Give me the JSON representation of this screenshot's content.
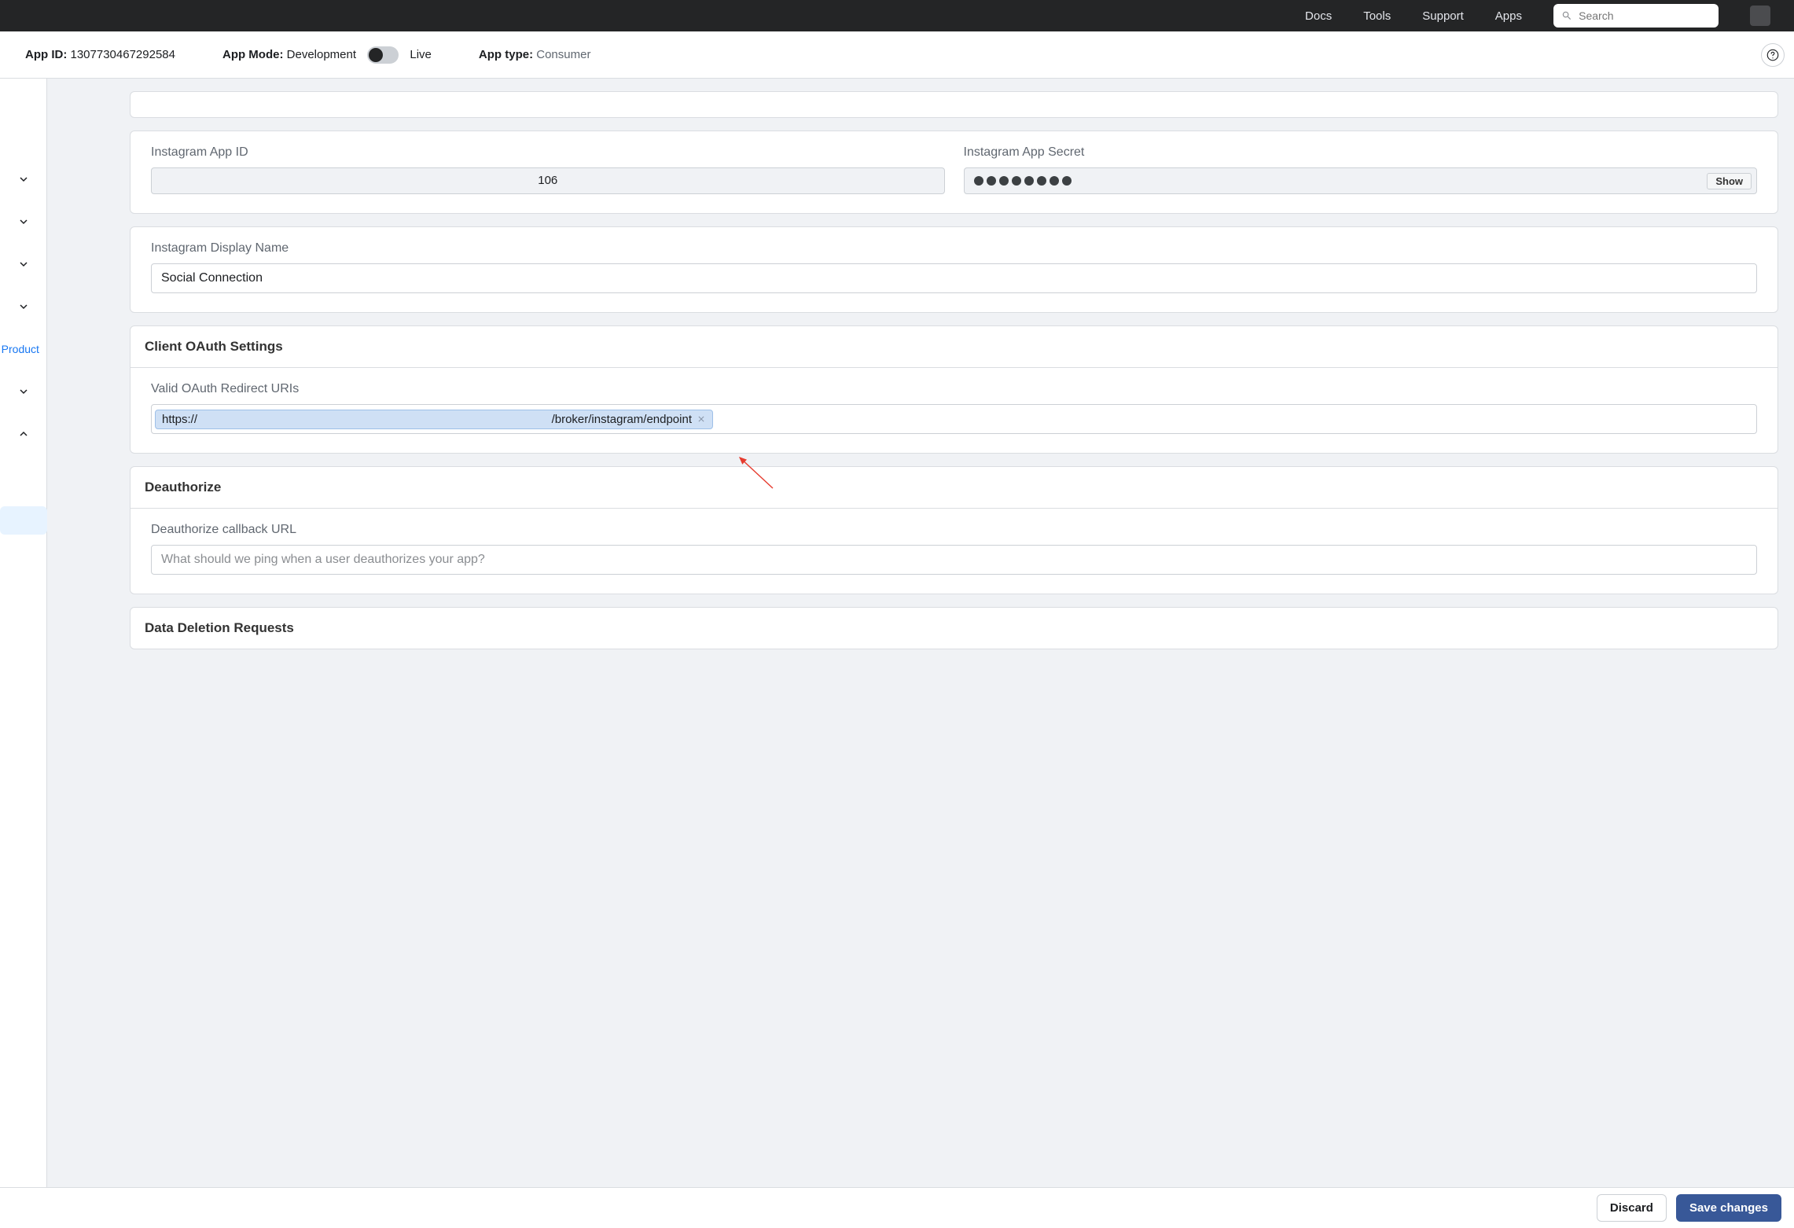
{
  "topnav": {
    "items": [
      "Docs",
      "Tools",
      "Support",
      "Apps"
    ],
    "search_placeholder": "Search"
  },
  "appbar": {
    "app_id_label": "App ID:",
    "app_id_value": "1307730467292584",
    "mode_label": "App Mode:",
    "mode_value": "Development",
    "mode_alt": "Live",
    "type_label": "App type:",
    "type_value": "Consumer"
  },
  "sidebar": {
    "add_product_label": "d Product"
  },
  "ig": {
    "app_id_label": "Instagram App ID",
    "app_id_value": "106",
    "secret_label": "Instagram App Secret",
    "show_label": "Show",
    "display_name_label": "Instagram Display Name",
    "display_name_value": "Social Connection"
  },
  "oauth": {
    "section_title": "Client OAuth Settings",
    "redirect_label": "Valid OAuth Redirect URIs",
    "uri_prefix": "https://",
    "uri_suffix": "/broker/instagram/endpoint"
  },
  "deauth": {
    "section_title": "Deauthorize",
    "callback_label": "Deauthorize callback URL",
    "callback_placeholder": "What should we ping when a user deauthorizes your app?"
  },
  "data_deletion": {
    "section_title": "Data Deletion Requests"
  },
  "footer": {
    "discard_label": "Discard",
    "save_label": "Save changes"
  }
}
